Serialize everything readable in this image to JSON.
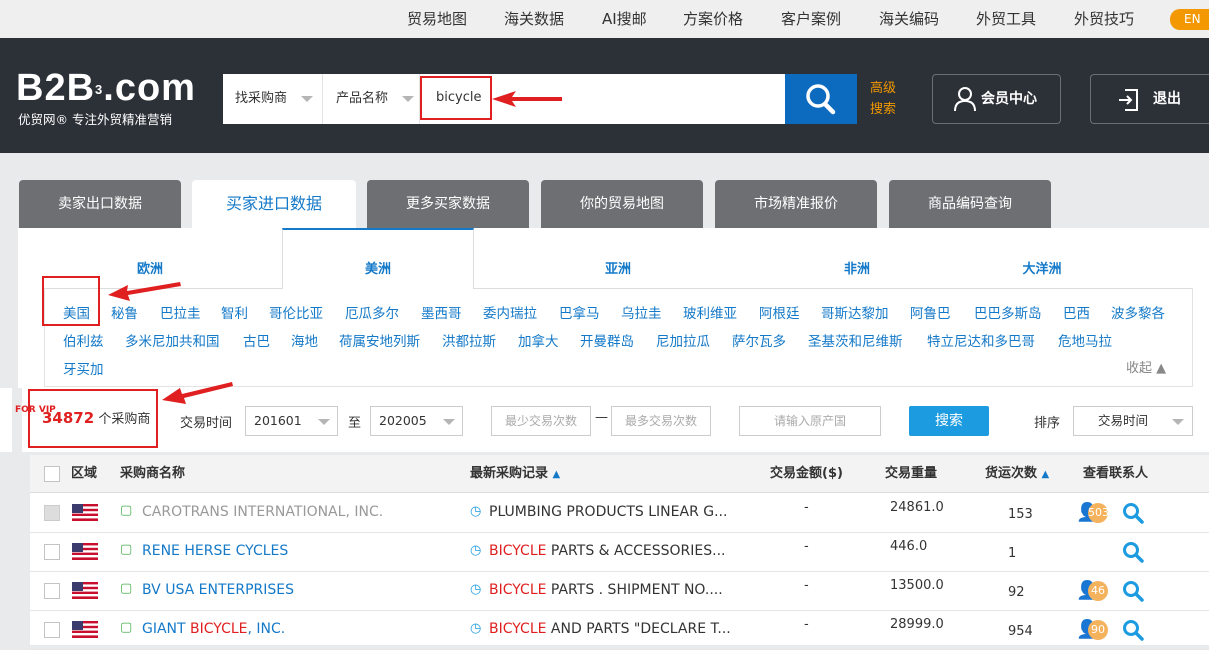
{
  "topnav": [
    "贸易地图",
    "海关数据",
    "AI搜邮",
    "方案价格",
    "客户案例",
    "海关编码",
    "外贸工具",
    "外贸技巧"
  ],
  "lang": "EN",
  "logo": {
    "main": "B2B",
    "sup": "3",
    "suffix": ".com",
    "slogan": "优贸网® 专注外贸精准营销"
  },
  "search": {
    "type": "找采购商",
    "field": "产品名称",
    "query": "bicycle",
    "advanced": "高级搜索"
  },
  "member_center": "会员中心",
  "logout": "退出",
  "tabs": [
    "卖家出口数据",
    "买家进口数据",
    "更多买家数据",
    "你的贸易地图",
    "市场精准报价",
    "商品编码查询"
  ],
  "regions": [
    "欧洲",
    "美洲",
    "亚洲",
    "非洲",
    "大洋洲"
  ],
  "countries_row1": [
    "美国",
    "秘鲁",
    "巴拉圭",
    "智利",
    "哥伦比亚",
    "厄瓜多尔",
    "墨西哥",
    "委内瑞拉",
    "巴拿马",
    "乌拉圭",
    "玻利维亚",
    "阿根廷",
    "哥斯达黎加",
    "阿鲁巴",
    "巴巴多斯岛",
    "巴西",
    "波多黎各"
  ],
  "countries_row2": [
    "伯利兹",
    "多米尼加共和国",
    "古巴",
    "海地",
    "荷属安地列斯",
    "洪都拉斯",
    "加拿大",
    "开曼群岛",
    "尼加拉瓜",
    "萨尔瓦多",
    "圣基茨和尼维斯",
    "特立尼达和多巴哥",
    "危地马拉"
  ],
  "countries_row3": [
    "牙买加"
  ],
  "collapse": "收起",
  "vip": "FOR VIP",
  "result": {
    "count": "34872",
    "unit": "个采购商"
  },
  "filter": {
    "time_label": "交易时间",
    "from": "201601",
    "to_label": "至",
    "to": "202005",
    "min_ph": "最少交易次数",
    "max_ph": "最多交易次数",
    "origin_ph": "请输入原产国",
    "search": "搜索",
    "sort_label": "排序",
    "sort": "交易时间"
  },
  "columns": [
    "区域",
    "采购商名称",
    "最新采购记录",
    "交易金额($)",
    "交易重量",
    "货运次数",
    "查看联系人"
  ],
  "rows": [
    {
      "buyer": "CAROTRANS INTERNATIONAL, INC.",
      "rec_pre": "",
      "rec_hl": "",
      "rec": "PLUMBING PRODUCTS LINEAR G...",
      "amount": "-",
      "weight": "24861.0",
      "shipments": "153",
      "contacts": "503"
    },
    {
      "buyer": "RENE HERSE CYCLES",
      "rec_pre": "",
      "rec_hl": "BICYCLE",
      "rec": " PARTS & ACCESSORIES...",
      "amount": "-",
      "weight": "446.0",
      "shipments": "1",
      "contacts": ""
    },
    {
      "buyer": "BV USA ENTERPRISES",
      "rec_pre": "",
      "rec_hl": "BICYCLE",
      "rec": " PARTS . SHIPMENT NO....",
      "amount": "-",
      "weight": "13500.0",
      "shipments": "92",
      "contacts": "46"
    },
    {
      "buyer_pre": "GIANT ",
      "buyer_hl": "BICYCLE",
      "buyer_post": ", INC.",
      "rec_hl": "BICYCLE",
      "rec": " AND PARTS \"DECLARE T...",
      "amount": "-",
      "weight": "28999.0",
      "shipments": "954",
      "contacts": "90"
    }
  ],
  "colors": {
    "accent": "#1479c8",
    "highlight": "#e02020",
    "orange": "#f39800"
  }
}
